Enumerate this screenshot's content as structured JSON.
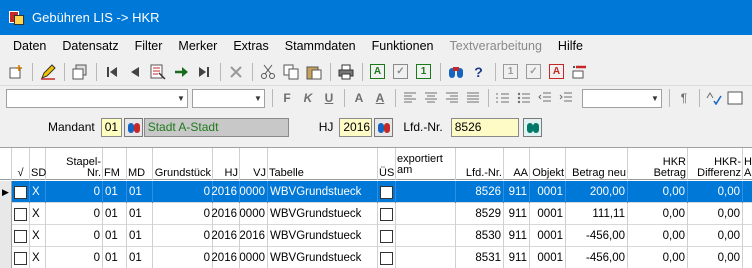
{
  "window": {
    "title": "Gebühren LIS -> HKR"
  },
  "menu": [
    "Daten",
    "Datensatz",
    "Filter",
    "Merker",
    "Extras",
    "Stammdaten",
    "Funktionen",
    "Textverarbeitung",
    "Hilfe"
  ],
  "menu_disabled": [
    "Textverarbeitung"
  ],
  "toolbar1": {
    "boxed_a_label": "A",
    "boxed_check_label": "✓",
    "boxed_one_label": "1",
    "binoc_q_label": "?",
    "dim_one_label": "1",
    "dim_check_label": "✓",
    "red_a_label": "A"
  },
  "toolbar2": {
    "bold": "F",
    "italic": "K",
    "underline": "U",
    "font_a1": "A",
    "font_a2": "A",
    "para": "¶"
  },
  "filter": {
    "mandant_label": "Mandant",
    "mandant_code": "01",
    "mandant_name": "Stadt A-Stadt",
    "hj_label": "HJ",
    "hj_value": "2016",
    "lfdnr_label": "Lfd.-Nr.",
    "lfdnr_value": "8526"
  },
  "grid": {
    "headers": {
      "check": "√",
      "sd": "SD",
      "stapel": "Stapel-\nNr.",
      "fm": "FM",
      "md": "MD",
      "grundstueck": "Grundstück",
      "hj": "HJ",
      "vj": "VJ",
      "tabelle": "Tabelle",
      "us": "ÜS",
      "exportiert": "exportiert\nam",
      "lfdnr": "Lfd.-Nr.",
      "aa": "AA",
      "objekt": "Objekt",
      "betrag_neu": "Betrag neu",
      "hkr_betrag": "HKR Betrag",
      "hkr_diff": "HKR-\nDifferenz",
      "extra": "H\nA"
    },
    "rows": [
      {
        "sd": "X",
        "stapel": "0",
        "fm": "01",
        "md": "01",
        "grundstueck": "0",
        "hj": "2016",
        "vj": "0000",
        "tabelle": "WBVGrundstueck",
        "lfdnr": "8526",
        "aa": "911",
        "objekt": "0001",
        "betrag_neu": "200,00",
        "hkr_betrag": "0,00",
        "hkr_diff": "0,00",
        "selected": true
      },
      {
        "sd": "X",
        "stapel": "0",
        "fm": "01",
        "md": "01",
        "grundstueck": "0",
        "hj": "2016",
        "vj": "0000",
        "tabelle": "WBVGrundstueck",
        "lfdnr": "8529",
        "aa": "911",
        "objekt": "0001",
        "betrag_neu": "111,11",
        "hkr_betrag": "0,00",
        "hkr_diff": "0,00",
        "selected": false
      },
      {
        "sd": "X",
        "stapel": "0",
        "fm": "01",
        "md": "01",
        "grundstueck": "0",
        "hj": "2016",
        "vj": "2016",
        "tabelle": "WBVGrundstueck",
        "lfdnr": "8530",
        "aa": "911",
        "objekt": "0001",
        "betrag_neu": "-456,00",
        "hkr_betrag": "0,00",
        "hkr_diff": "0,00",
        "selected": false
      },
      {
        "sd": "X",
        "stapel": "0",
        "fm": "01",
        "md": "01",
        "grundstueck": "0",
        "hj": "2016",
        "vj": "0000",
        "tabelle": "WBVGrundstueck",
        "lfdnr": "8531",
        "aa": "911",
        "objekt": "0001",
        "betrag_neu": "-456,00",
        "hkr_betrag": "0,00",
        "hkr_diff": "0,00",
        "selected": false
      }
    ]
  },
  "colors": {
    "titlebar": "#0078d7",
    "selection": "#0078d7",
    "mandant_bg": "#ffffc0",
    "mandant_name_bg": "#c8c8c8",
    "mandant_name_text": "#1f7a1f",
    "yellow_field": "#fffbc6"
  }
}
